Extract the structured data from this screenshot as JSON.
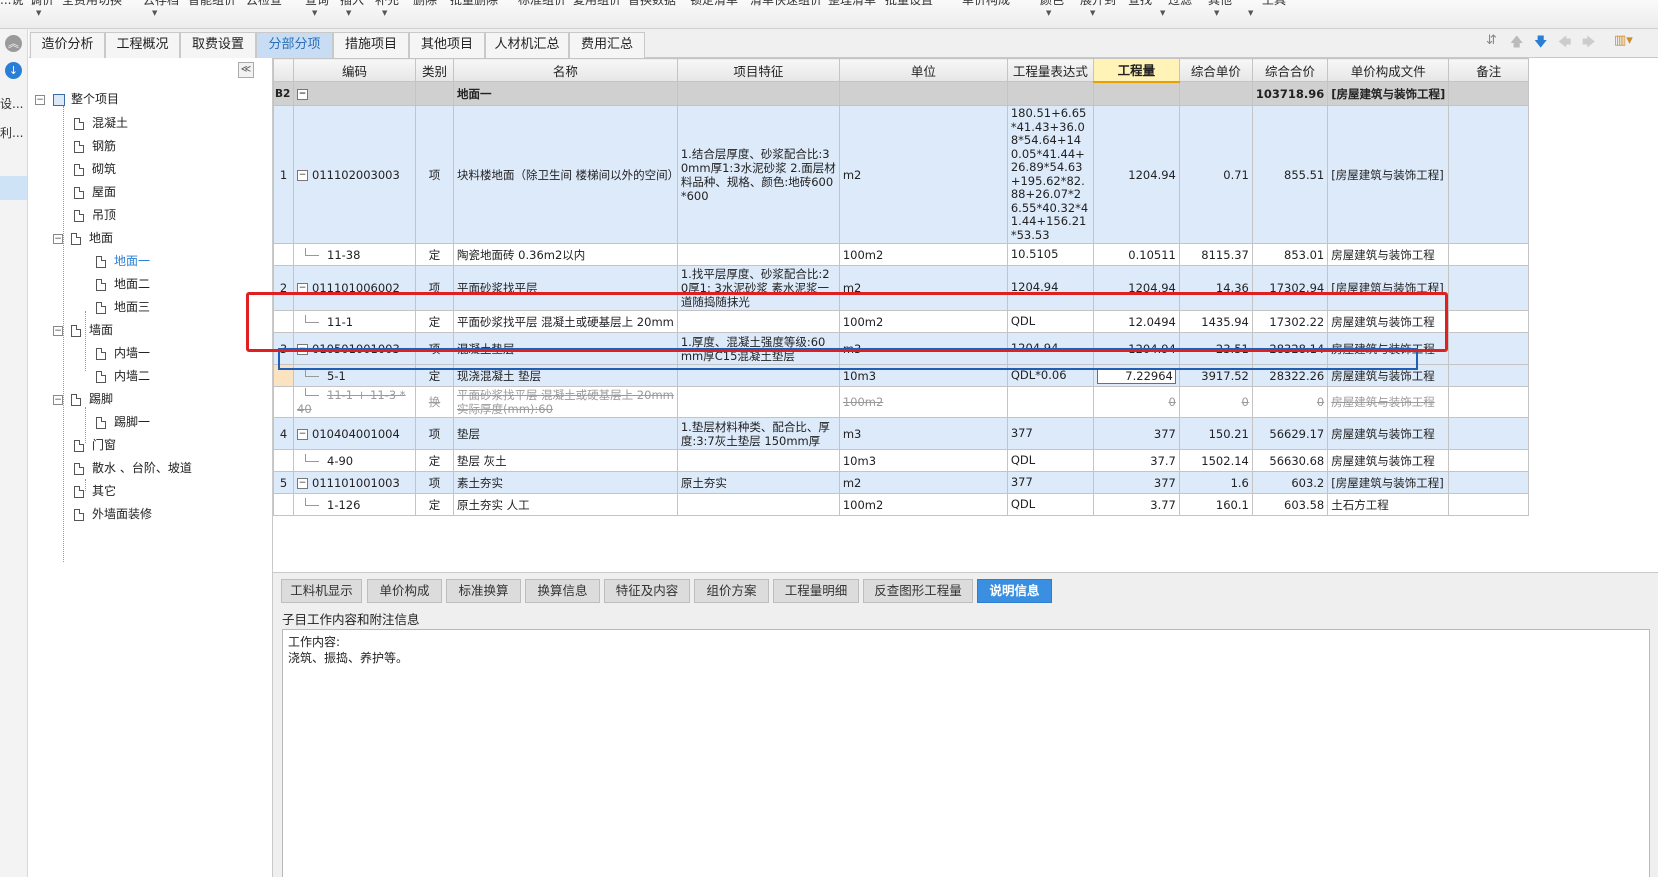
{
  "toolbar": {
    "items": [
      "...说",
      "调价",
      "全费用切换",
      "云存档",
      "智能组价",
      "云检查",
      "查询",
      "插入",
      "补充",
      "删除",
      "批量删除",
      "标准组价",
      "复用组价",
      "替换数据",
      "锁定清单",
      "清单快速组价",
      "整理清单",
      "批量设置",
      "单价构成",
      "颜色",
      "展开到",
      "查找",
      "过滤",
      "其他",
      "工具"
    ]
  },
  "left_strip": {
    "text1": "设...",
    "text2": "利..."
  },
  "tabs": [
    {
      "label": "造价分析"
    },
    {
      "label": "工程概况"
    },
    {
      "label": "取费设置"
    },
    {
      "label": "分部分项",
      "active": true
    },
    {
      "label": "措施项目"
    },
    {
      "label": "其他项目"
    },
    {
      "label": "人材机汇总"
    },
    {
      "label": "费用汇总"
    }
  ],
  "tree": {
    "root": "整个项目",
    "nodes": [
      "混凝土",
      "钢筋",
      "砌筑",
      "屋面",
      "吊顶",
      "地面",
      "地面一",
      "地面二",
      "地面三",
      "墙面",
      "内墙一",
      "内墙二",
      "踢脚",
      "踢脚一",
      "门窗",
      "散水 、台阶、坡道",
      "其它",
      "外墙面装修"
    ]
  },
  "grid": {
    "headers": [
      "编码",
      "类别",
      "名称",
      "项目特征",
      "单位",
      "工程量表达式",
      "工程量",
      "综合单价",
      "综合合价",
      "单价构成文件",
      "备注"
    ],
    "group_row": {
      "no": "B2",
      "name": "地面一",
      "total": "103718.96",
      "file": "[房屋建筑与装饰工程]"
    },
    "rows": [
      {
        "no": "1",
        "code": "011102003003",
        "type": "项",
        "name": "块料楼地面（除卫生间 楼梯间以外的空间）",
        "feature": "1.结合层厚度、砂浆配合比:30mm厚1:3水泥砂浆\n2.面层材料品种、规格、颜色:地砖600*600",
        "unit": "m2",
        "expr": "180.51+6.65*41.43+36.08*54.64+140.05*41.44+26.89*54.63+195.62*82.88+26.07*26.55*40.32*41.44+156.21*53.53",
        "qty": "1204.94",
        "price": "0.71",
        "total": "855.51",
        "file": "[房屋建筑与装饰工程]"
      },
      {
        "no": "",
        "code": "11-38",
        "type": "定",
        "name": "陶瓷地面砖 0.36m2以内",
        "feature": "",
        "unit": "100m2",
        "expr": "10.5105",
        "qty": "0.10511",
        "price": "8115.37",
        "total": "853.01",
        "file": "房屋建筑与装饰工程"
      },
      {
        "no": "2",
        "code": "011101006002",
        "type": "项",
        "name": "平面砂浆找平层",
        "feature": "1.找平层厚度、砂浆配合比:20厚1: 3水泥砂浆 素水泥浆一道随捣随抹光",
        "unit": "m2",
        "expr": "1204.94",
        "qty": "1204.94",
        "price": "14.36",
        "total": "17302.94",
        "file": "[房屋建筑与装饰工程]"
      },
      {
        "no": "",
        "code": "11-1",
        "type": "定",
        "name": "平面砂浆找平层 混凝土或硬基层上 20mm",
        "feature": "",
        "unit": "100m2",
        "expr": "QDL",
        "qty": "12.0494",
        "price": "1435.94",
        "total": "17302.22",
        "file": "房屋建筑与装饰工程"
      },
      {
        "no": "3",
        "code": "010501001003",
        "type": "项",
        "name": "混凝土垫层",
        "feature": "1.厚度、混凝土强度等级:60mm厚C15混凝土垫层",
        "unit": "m3",
        "expr": "1204.94",
        "qty": "1204.94",
        "price": "23.51",
        "total": "28328.14",
        "file": "房屋建筑与装饰工程"
      },
      {
        "no": "",
        "code": "5-1",
        "type": "定",
        "name": "现浇混凝土 垫层",
        "feature": "",
        "unit": "10m3",
        "expr": "QDL*0.06",
        "qty": "7.22964",
        "price": "3917.52",
        "total": "28322.26",
        "file": "房屋建筑与装饰工程"
      },
      {
        "no": "",
        "code": "11-1 + 11-3 * 40",
        "type": "换",
        "name": "平面砂浆找平层 混凝土或硬基层上 20mm 实际厚度(mm):60",
        "feature": "",
        "unit": "100m2",
        "expr": "",
        "qty": "0",
        "price": "0",
        "total": "0",
        "file": "房屋建筑与装饰工程"
      },
      {
        "no": "4",
        "code": "010404001004",
        "type": "项",
        "name": "垫层",
        "feature": "1.垫层材料种类、配合比、厚度:3:7灰土垫层 150mm厚",
        "unit": "m3",
        "expr": "377",
        "qty": "377",
        "price": "150.21",
        "total": "56629.17",
        "file": "房屋建筑与装饰工程"
      },
      {
        "no": "",
        "code": "4-90",
        "type": "定",
        "name": "垫层 灰土",
        "feature": "",
        "unit": "10m3",
        "expr": "QDL",
        "qty": "37.7",
        "price": "1502.14",
        "total": "56630.68",
        "file": "房屋建筑与装饰工程"
      },
      {
        "no": "5",
        "code": "011101001003",
        "type": "项",
        "name": "素土夯实",
        "feature": "原土夯实",
        "unit": "m2",
        "expr": "377",
        "qty": "377",
        "price": "1.6",
        "total": "603.2",
        "file": "[房屋建筑与装饰工程]"
      },
      {
        "no": "",
        "code": "1-126",
        "type": "定",
        "name": "原土夯实 人工",
        "feature": "",
        "unit": "100m2",
        "expr": "QDL",
        "qty": "3.77",
        "price": "160.1",
        "total": "603.58",
        "file": "土石方工程"
      }
    ]
  },
  "bottom": {
    "tabs": [
      {
        "label": "工料机显示"
      },
      {
        "label": "单价构成"
      },
      {
        "label": "标准换算"
      },
      {
        "label": "换算信息"
      },
      {
        "label": "特征及内容"
      },
      {
        "label": "组价方案"
      },
      {
        "label": "工程量明细"
      },
      {
        "label": "反查图形工程量"
      },
      {
        "label": "说明信息",
        "active": true
      }
    ],
    "title": "子目工作内容和附注信息",
    "content_line1": "工作内容:",
    "content_line2": "浇筑、振捣、养护等。"
  },
  "colors": {
    "accent": "#2a7fd4",
    "highlight_box": "#e02020",
    "row_blue": "#ddeafa",
    "group_gray": "#d0d0d0"
  }
}
